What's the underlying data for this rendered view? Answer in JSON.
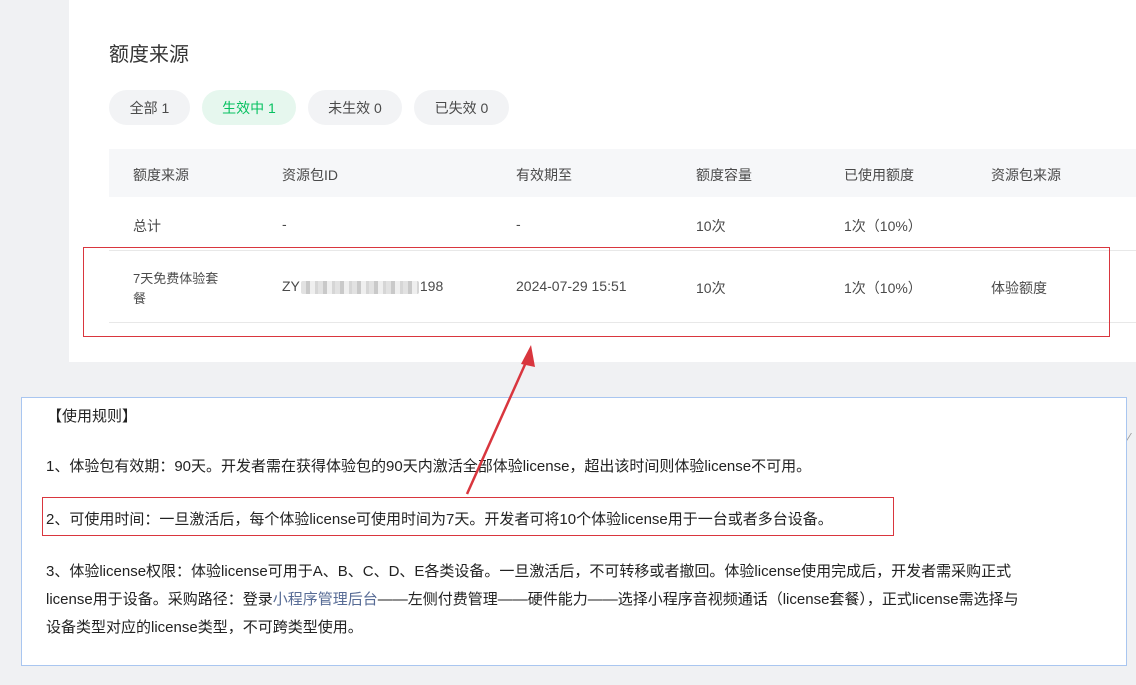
{
  "section": {
    "title": "额度来源"
  },
  "tabs": [
    {
      "label": "全部 1",
      "active": false
    },
    {
      "label": "生效中 1",
      "active": true
    },
    {
      "label": "未生效 0",
      "active": false
    },
    {
      "label": "已失效 0",
      "active": false
    }
  ],
  "table": {
    "headers": [
      "额度来源",
      "资源包ID",
      "有效期至",
      "额度容量",
      "已使用额度",
      "资源包来源"
    ],
    "total_row": {
      "source": "总计",
      "id": "-",
      "expiry": "-",
      "capacity": "10次",
      "used": "1次（10%）",
      "origin": ""
    },
    "package_row": {
      "source_line1": "7天免费体验套",
      "source_line2": "餐",
      "id_prefix": "ZY",
      "id_suffix": "198",
      "expiry": "2024-07-29 15:51",
      "capacity": "10次",
      "used": "1次（10%）",
      "origin": "体验额度"
    }
  },
  "rules": {
    "title": "【使用规则】",
    "rule1": "1、体验包有效期：90天。开发者需在获得体验包的90天内激活全部体验license，超出该时间则体验license不可用。",
    "rule2": "2、可使用时间：一旦激活后，每个体验license可使用时间为7天。开发者可将10个体验license用于一台或者多台设备。",
    "rule3_line1": "3、体验license权限：体验license可用于A、B、C、D、E各类设备。一旦激活后，不可转移或者撤回。体验license使用完成后，开发者需采购正式",
    "rule3_line2_pre": "license用于设备。采购路径：登录",
    "rule3_link": "小程序管理后台",
    "rule3_line2_post": "——左侧付费管理——硬件能力——选择小程序音视频通话（license套餐），正式license需选择与",
    "rule3_line3": "设备类型对应的license类型，不可跨类型使用。"
  },
  "annotation_color": "#d9363e",
  "accent_color": "#07c160"
}
